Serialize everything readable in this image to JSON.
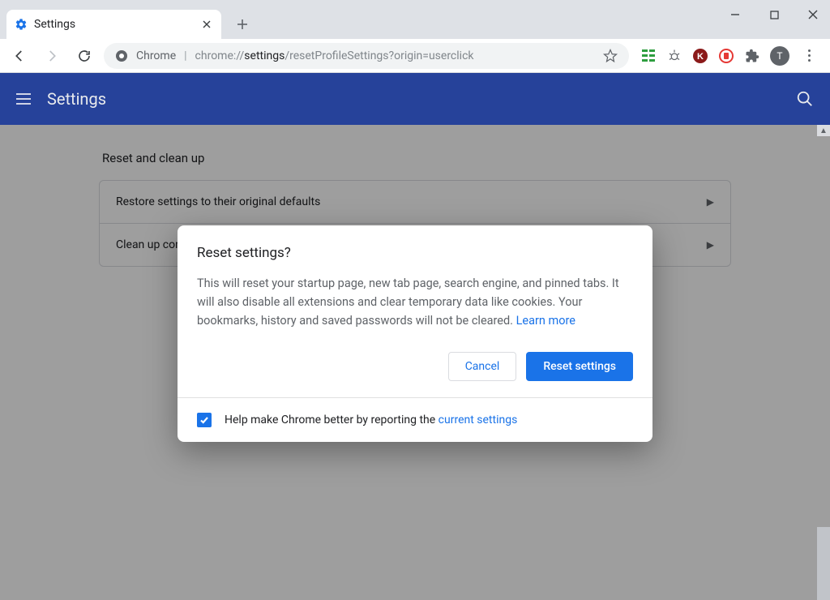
{
  "window": {
    "tab_title": "Settings"
  },
  "omnibox": {
    "prefix": "Chrome",
    "url_gray_lead": "chrome://",
    "url_dark": "settings",
    "url_gray_tail": "/resetProfileSettings?origin=userclick"
  },
  "profile": {
    "initial": "T"
  },
  "settings_header": {
    "title": "Settings"
  },
  "section": {
    "heading": "Reset and clean up",
    "rows": [
      {
        "label": "Restore settings to their original defaults"
      },
      {
        "label": "Clean up computer"
      }
    ]
  },
  "dialog": {
    "title": "Reset settings?",
    "body": "This will reset your startup page, new tab page, search engine, and pinned tabs. It will also disable all extensions and clear temporary data like cookies. Your bookmarks, history and saved passwords will not be cleared. ",
    "learn_more": "Learn more",
    "cancel": "Cancel",
    "confirm": "Reset settings",
    "footer_lead": "Help make Chrome better by reporting the ",
    "footer_link": "current settings"
  }
}
